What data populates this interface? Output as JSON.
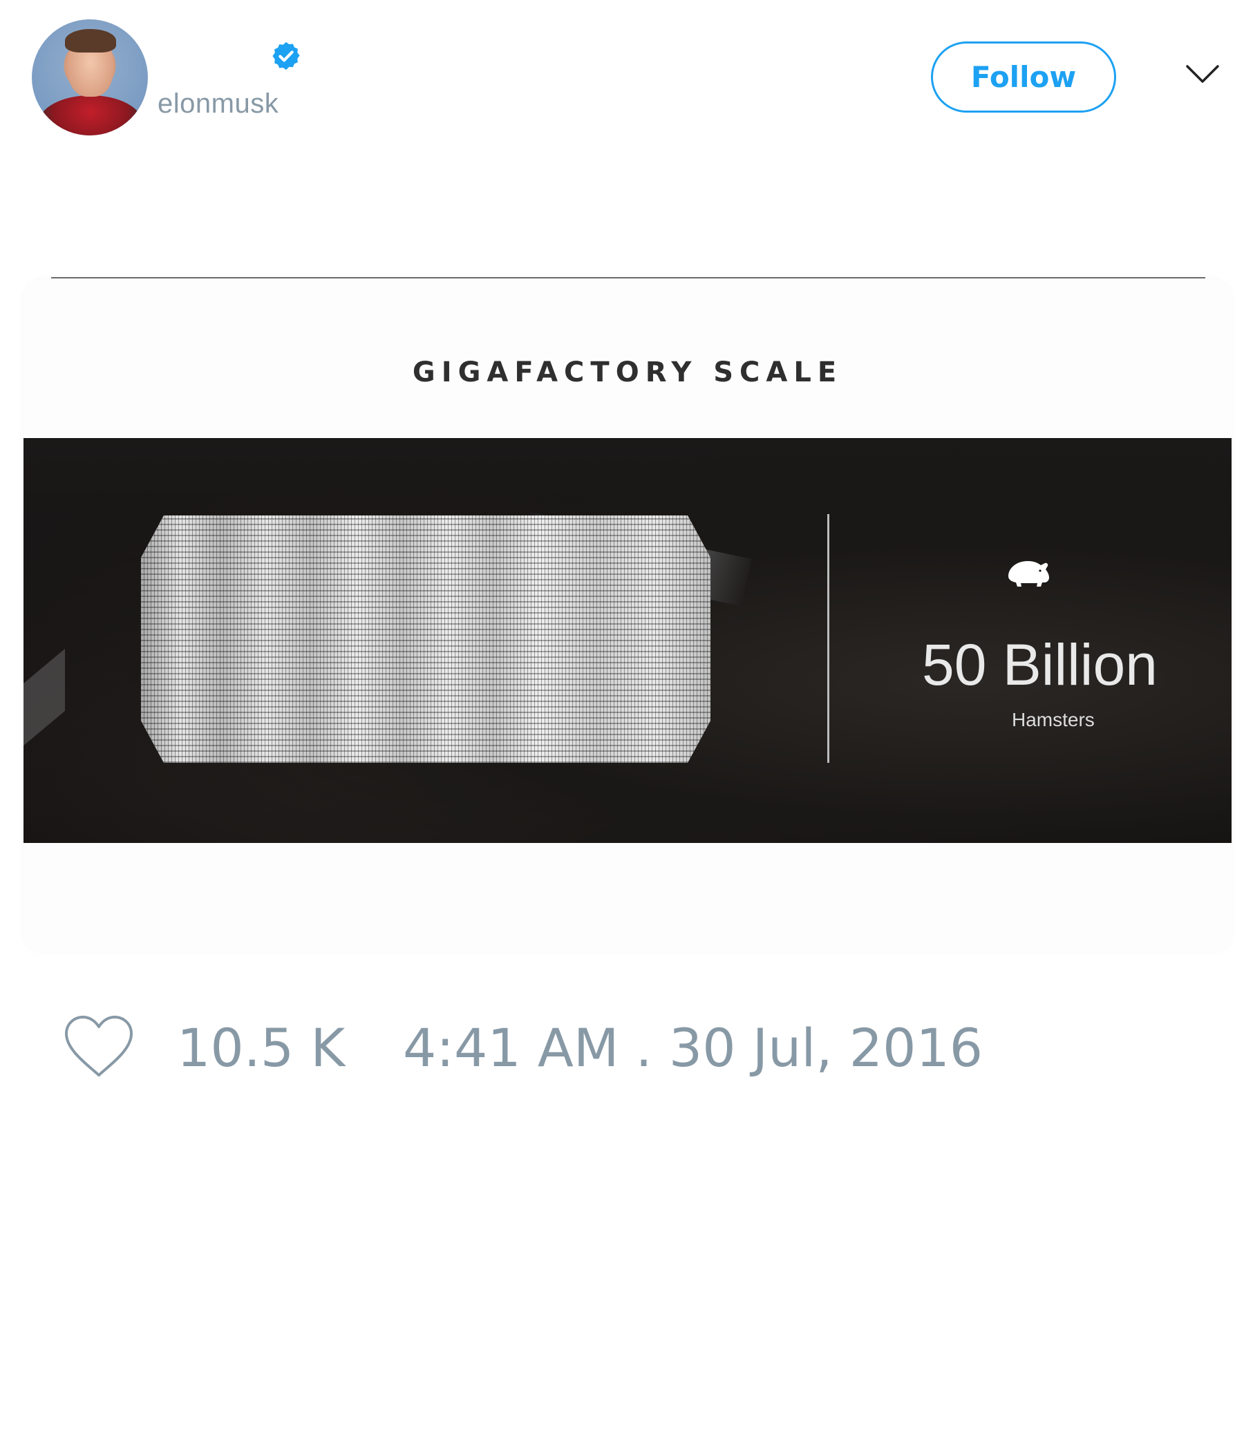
{
  "tweet": {
    "author": {
      "handle": "elonmusk",
      "verified": true
    },
    "follow_label": "Follow",
    "menu_icon": "chevron-down-icon",
    "media": {
      "title": "GIGAFACTORY SCALE",
      "stat_value": "50 Billion",
      "stat_label": "Hamsters",
      "stat_icon": "hamster-icon"
    },
    "likes": "10.5 K",
    "timestamp": "4:41 AM . 30 Jul, 2016"
  },
  "colors": {
    "accent": "#1da1f2",
    "muted_text": "#8899a6",
    "divider": "#6b6b6b",
    "media_dark": "#141212"
  }
}
